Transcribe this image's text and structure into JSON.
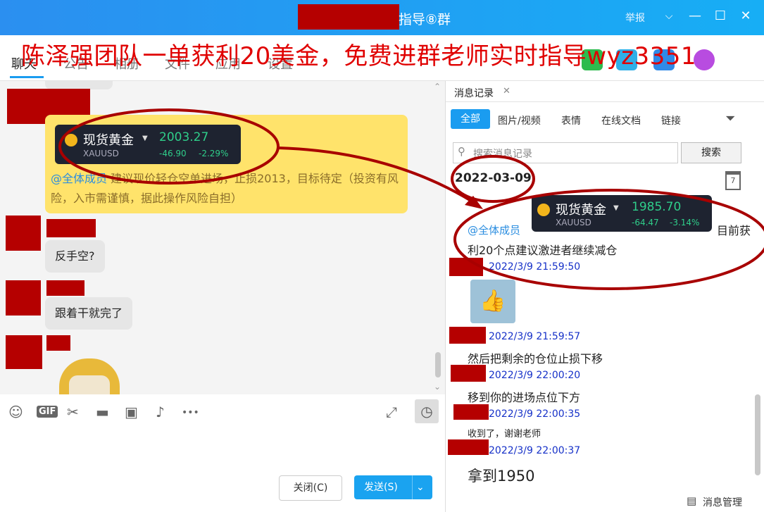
{
  "window": {
    "title": "指导⑧群",
    "report_label": "举报",
    "min_glyph": "—",
    "max_glyph": "☐",
    "close_glyph": "✕",
    "accent": "#1a9cf0"
  },
  "overlay_text": "陈泽强团队一单获利20美金，免费进群老师实时指导wyz3351",
  "tabs": [
    "聊天",
    "公告",
    "相册",
    "文件",
    "应用",
    "设置"
  ],
  "chat": {
    "card_left": {
      "name": "现货黄金",
      "code": "XAUUSD",
      "price": "2003.27",
      "change": "-46.90",
      "change_pct": "-2.29%"
    },
    "mention": "@全体成员",
    "yellow_text": "建议现价轻仓空单进场，止损2013，目标待定（投资有风险，入市需谨慎，据此操作风险自担）",
    "bubble1": "反手空?",
    "bubble2": "跟着干就完了"
  },
  "toolbar": {
    "gif_label": "GIF",
    "more_glyph": "•••",
    "close_label": "关闭(C)",
    "send_label": "发送(S)",
    "send_caret": "⌄"
  },
  "history": {
    "tab_label": "消息记录",
    "tab_close": "✕",
    "filters": [
      "全部",
      "图片/视频",
      "表情",
      "在线文档",
      "链接"
    ],
    "search_placeholder": "搜索消息记录",
    "search_button": "搜索",
    "date": "2022-03-09",
    "calendar_day": "7",
    "card": {
      "name": "现货黄金",
      "code": "XAUUSD",
      "price": "1985.70",
      "change": "-64.47",
      "change_pct": "-3.14%"
    },
    "mention": "@全体成员",
    "partial_right": "目前获",
    "msg_partial": "利20个点建议激进者继续减仓",
    "entries": [
      {
        "time": "2022/3/9 21:59:50",
        "text": ""
      },
      {
        "time": "2022/3/9 21:59:57",
        "text": "然后把剩余的仓位止损下移"
      },
      {
        "time": "2022/3/9 22:00:20",
        "text": "移到你的进场点位下方"
      },
      {
        "time": "2022/3/9 22:00:35",
        "text": "收到了，谢谢老师"
      },
      {
        "time": "2022/3/9 22:00:37",
        "text": "拿到1950"
      }
    ],
    "manage_label": "消息管理"
  }
}
